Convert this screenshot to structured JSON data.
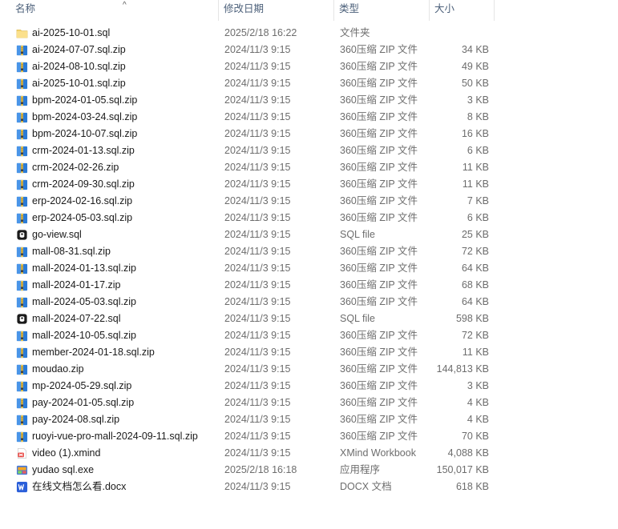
{
  "columns": {
    "name": "名称",
    "date": "修改日期",
    "type": "类型",
    "size": "大小",
    "sort_glyph": "^"
  },
  "colors": {
    "header_text": "#4c607a",
    "folder": "#f7d774",
    "zip_blue": "#2b7bd6",
    "word_blue": "#2b5fd9",
    "xmind_red": "#e8413c"
  },
  "files": [
    {
      "name": "ai-2025-10-01.sql",
      "date": "2025/2/18 16:22",
      "type": "文件夹",
      "size": "",
      "icon": "folder-icon"
    },
    {
      "name": "ai-2024-07-07.sql.zip",
      "date": "2024/11/3 9:15",
      "type": "360压缩 ZIP 文件",
      "size": "34 KB",
      "icon": "zip-archive-icon"
    },
    {
      "name": "ai-2024-08-10.sql.zip",
      "date": "2024/11/3 9:15",
      "type": "360压缩 ZIP 文件",
      "size": "49 KB",
      "icon": "zip-archive-icon"
    },
    {
      "name": "ai-2025-10-01.sql.zip",
      "date": "2024/11/3 9:15",
      "type": "360压缩 ZIP 文件",
      "size": "50 KB",
      "icon": "zip-archive-icon"
    },
    {
      "name": "bpm-2024-01-05.sql.zip",
      "date": "2024/11/3 9:15",
      "type": "360压缩 ZIP 文件",
      "size": "3 KB",
      "icon": "zip-archive-icon"
    },
    {
      "name": "bpm-2024-03-24.sql.zip",
      "date": "2024/11/3 9:15",
      "type": "360压缩 ZIP 文件",
      "size": "8 KB",
      "icon": "zip-archive-icon"
    },
    {
      "name": "bpm-2024-10-07.sql.zip",
      "date": "2024/11/3 9:15",
      "type": "360压缩 ZIP 文件",
      "size": "16 KB",
      "icon": "zip-archive-icon"
    },
    {
      "name": "crm-2024-01-13.sql.zip",
      "date": "2024/11/3 9:15",
      "type": "360压缩 ZIP 文件",
      "size": "6 KB",
      "icon": "zip-archive-icon"
    },
    {
      "name": "crm-2024-02-26.zip",
      "date": "2024/11/3 9:15",
      "type": "360压缩 ZIP 文件",
      "size": "11 KB",
      "icon": "zip-archive-icon"
    },
    {
      "name": "crm-2024-09-30.sql.zip",
      "date": "2024/11/3 9:15",
      "type": "360压缩 ZIP 文件",
      "size": "11 KB",
      "icon": "zip-archive-icon"
    },
    {
      "name": "erp-2024-02-16.sql.zip",
      "date": "2024/11/3 9:15",
      "type": "360压缩 ZIP 文件",
      "size": "7 KB",
      "icon": "zip-archive-icon"
    },
    {
      "name": "erp-2024-05-03.sql.zip",
      "date": "2024/11/3 9:15",
      "type": "360压缩 ZIP 文件",
      "size": "6 KB",
      "icon": "zip-archive-icon"
    },
    {
      "name": "go-view.sql",
      "date": "2024/11/3 9:15",
      "type": "SQL file",
      "size": "25 KB",
      "icon": "sql-file-icon"
    },
    {
      "name": "mall-08-31.sql.zip",
      "date": "2024/11/3 9:15",
      "type": "360压缩 ZIP 文件",
      "size": "72 KB",
      "icon": "zip-archive-icon"
    },
    {
      "name": "mall-2024-01-13.sql.zip",
      "date": "2024/11/3 9:15",
      "type": "360压缩 ZIP 文件",
      "size": "64 KB",
      "icon": "zip-archive-icon"
    },
    {
      "name": "mall-2024-01-17.zip",
      "date": "2024/11/3 9:15",
      "type": "360压缩 ZIP 文件",
      "size": "68 KB",
      "icon": "zip-archive-icon"
    },
    {
      "name": "mall-2024-05-03.sql.zip",
      "date": "2024/11/3 9:15",
      "type": "360压缩 ZIP 文件",
      "size": "64 KB",
      "icon": "zip-archive-icon"
    },
    {
      "name": "mall-2024-07-22.sql",
      "date": "2024/11/3 9:15",
      "type": "SQL file",
      "size": "598 KB",
      "icon": "sql-file-icon"
    },
    {
      "name": "mall-2024-10-05.sql.zip",
      "date": "2024/11/3 9:15",
      "type": "360压缩 ZIP 文件",
      "size": "72 KB",
      "icon": "zip-archive-icon"
    },
    {
      "name": "member-2024-01-18.sql.zip",
      "date": "2024/11/3 9:15",
      "type": "360压缩 ZIP 文件",
      "size": "11 KB",
      "icon": "zip-archive-icon"
    },
    {
      "name": "moudao.zip",
      "date": "2024/11/3 9:15",
      "type": "360压缩 ZIP 文件",
      "size": "144,813 KB",
      "icon": "zip-archive-icon"
    },
    {
      "name": "mp-2024-05-29.sql.zip",
      "date": "2024/11/3 9:15",
      "type": "360压缩 ZIP 文件",
      "size": "3 KB",
      "icon": "zip-archive-icon"
    },
    {
      "name": "pay-2024-01-05.sql.zip",
      "date": "2024/11/3 9:15",
      "type": "360压缩 ZIP 文件",
      "size": "4 KB",
      "icon": "zip-archive-icon"
    },
    {
      "name": "pay-2024-08.sql.zip",
      "date": "2024/11/3 9:15",
      "type": "360压缩 ZIP 文件",
      "size": "4 KB",
      "icon": "zip-archive-icon"
    },
    {
      "name": "ruoyi-vue-pro-mall-2024-09-11.sql.zip",
      "date": "2024/11/3 9:15",
      "type": "360压缩 ZIP 文件",
      "size": "70 KB",
      "icon": "zip-archive-icon"
    },
    {
      "name": "video (1).xmind",
      "date": "2024/11/3 9:15",
      "type": "XMind Workbook",
      "size": "4,088 KB",
      "icon": "xmind-file-icon"
    },
    {
      "name": "yudao sql.exe",
      "date": "2025/2/18 16:18",
      "type": "应用程序",
      "size": "150,017 KB",
      "icon": "exe-app-icon"
    },
    {
      "name": "在线文档怎么看.docx",
      "date": "2024/11/3 9:15",
      "type": "DOCX 文档",
      "size": "618 KB",
      "icon": "word-document-icon"
    }
  ]
}
